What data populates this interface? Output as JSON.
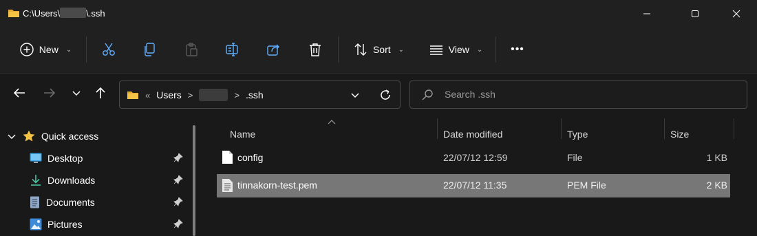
{
  "window": {
    "path_prefix": "C:\\Users\\",
    "path_suffix": "\\.ssh"
  },
  "toolbar": {
    "new_label": "New",
    "sort_label": "Sort",
    "view_label": "View",
    "more_label": "•••"
  },
  "address": {
    "overflow": "«",
    "crumbs": [
      "Users",
      ".ssh"
    ],
    "separator": ">"
  },
  "search": {
    "placeholder": "Search .ssh"
  },
  "sidebar": {
    "quick_access": "Quick access",
    "items": [
      {
        "label": "Desktop",
        "icon": "desktop-icon"
      },
      {
        "label": "Downloads",
        "icon": "downloads-icon"
      },
      {
        "label": "Documents",
        "icon": "documents-icon"
      },
      {
        "label": "Pictures",
        "icon": "pictures-icon"
      }
    ]
  },
  "columns": [
    "Name",
    "Date modified",
    "Type",
    "Size"
  ],
  "files": [
    {
      "name": "config",
      "date": "22/07/12 12:59",
      "type": "File",
      "size": "1 KB",
      "selected": false
    },
    {
      "name": "tinnakorn-test.pem",
      "date": "22/07/12 11:35",
      "type": "PEM File",
      "size": "2 KB",
      "selected": true
    }
  ],
  "colors": {
    "folder": "#f5c344",
    "accent": "#60b0ff",
    "selection": "#777777"
  }
}
